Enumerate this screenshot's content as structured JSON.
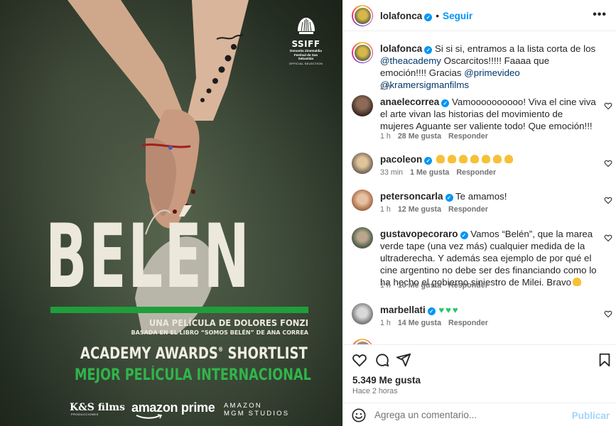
{
  "poster": {
    "festival_logo_text": "SSIFF",
    "festival_name": "Donostia Zinemaldia Festival de San Sebastián",
    "festival_selection": "OFFICIAL SELECTION",
    "title": "BELÉN",
    "director_line": "UNA PELÍCULA DE DOLORES FONZI",
    "based_on": "BASADA EN EL LIBRO “SOMOS BELÉN” DE ANA CORREA",
    "shortlist": "ACADEMY AWARDS",
    "shortlist_mark": "®",
    "shortlist_suffix": " SHORTLIST",
    "category": "MEJOR PELÍCULA INTERNACIONAL",
    "studio_ks": "K&S films",
    "studio_ks_sub": "PRODUCCIONES",
    "studio_amazon": "amazon prime",
    "studio_mgm_line1": "AMAZON",
    "studio_mgm_line2": "MGM STUDIOS",
    "accent_green": "#1f9e3a"
  },
  "header": {
    "username": "lolafonca",
    "separator": "•",
    "follow_label": "Seguir",
    "more_label": "•••"
  },
  "caption": {
    "username": "lolafonca",
    "text_1": "Si si si, entramos a la lista corta de los ",
    "mention_1": "@theacademy",
    "text_2": " Oscarcitos!!!!! Faaaa que emoción!!!! Gracias ",
    "mention_2": "@primevideo",
    "text_3": " ",
    "mention_3": "@kramersigmanfilms",
    "time": "2 h"
  },
  "comments": [
    {
      "username": "anaelecorrea",
      "text": "Vamoooooooooo! Viva el cine viva el arte vivan las historias del movimiento de mujeres Aguante ser valiente todo! Que emoción!!!",
      "time": "1 h",
      "likes": "28 Me gusta",
      "reply": "Responder"
    },
    {
      "username": "pacoleon",
      "text": "",
      "emoji": "clapping-hands",
      "emoji_count": 7,
      "time": "33 min",
      "likes": "1 Me gusta",
      "reply": "Responder"
    },
    {
      "username": "petersoncarla",
      "text": "Te amamos!",
      "time": "1 h",
      "likes": "12 Me gusta",
      "reply": "Responder"
    },
    {
      "username": "gustavopecoraro",
      "text": "Vamos “Belén”, que la marea verde tape (una vez más) cualquier medida de la ultraderecha. Y además sea ejemplo de por qué el cine argentino no debe ser des financiando como lo ha hecho el gobierno siniestro de Milei. Bravo",
      "emoji": "clapping-hands",
      "emoji_count": 1,
      "time": "1 h",
      "likes": "10 Me gusta",
      "reply": "Responder"
    },
    {
      "username": "marbellati",
      "text": "",
      "emoji": "green-heart",
      "emoji_count": 3,
      "time": "1 h",
      "likes": "14 Me gusta",
      "reply": "Responder"
    }
  ],
  "actions": {
    "likes": "5.349 Me gusta",
    "time_ago": "Hace 2 horas"
  },
  "composer": {
    "placeholder": "Agrega un comentario...",
    "publish_label": "Publicar"
  },
  "colors": {
    "link_blue": "#0095f6",
    "mention_blue": "#00376b",
    "secondary_text": "#737373",
    "publish_disabled": "#a3d5fb"
  }
}
